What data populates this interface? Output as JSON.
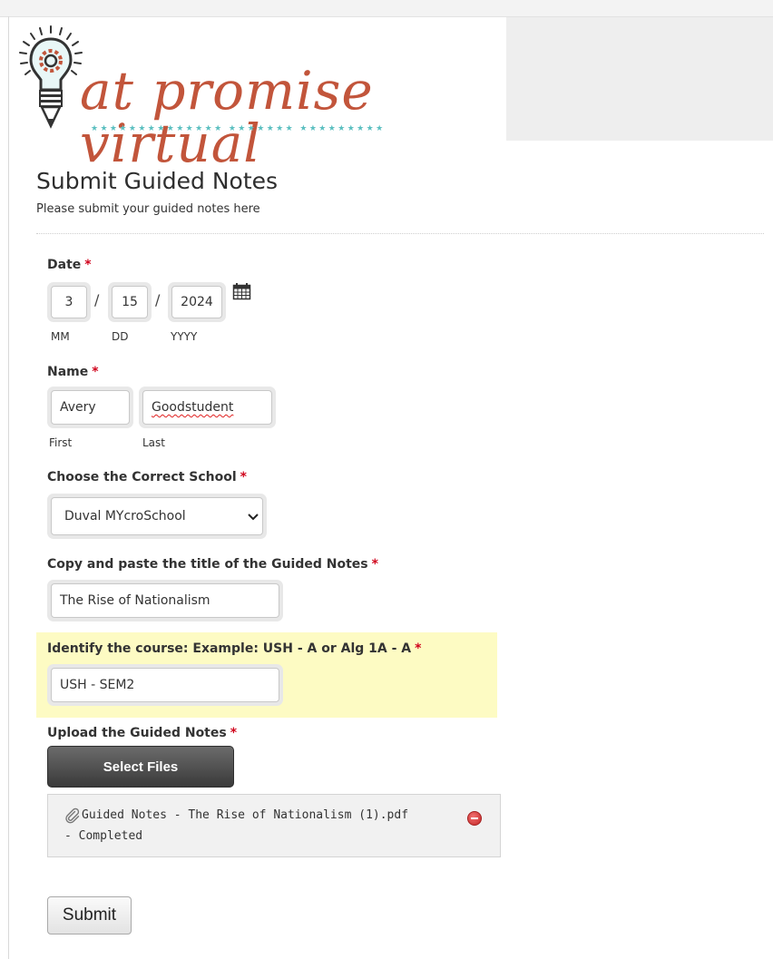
{
  "logo": {
    "text": "at promise virtual",
    "stars": "★★★★★★★★★★★★★★ ★★★★★★★ ★★★★★★★★★"
  },
  "form": {
    "title": "Submit Guided Notes",
    "description": "Please submit your guided notes here"
  },
  "date": {
    "label": "Date",
    "required": "*",
    "month": "3",
    "day": "15",
    "year": "2024",
    "separator": "/",
    "month_label": "MM",
    "day_label": "DD",
    "year_label": "YYYY"
  },
  "name": {
    "label": "Name",
    "required": "*",
    "first": "Avery",
    "last": "Goodstudent",
    "first_label": "First",
    "last_label": "Last"
  },
  "school": {
    "label": "Choose the Correct School",
    "required": "*",
    "selected": "Duval MYcroSchool"
  },
  "notes_title": {
    "label": "Copy and paste the title of the Guided Notes",
    "required": "*",
    "value": "The Rise of Nationalism"
  },
  "course": {
    "label": "Identify the course: Example: USH - A or Alg 1A - A",
    "required": "*",
    "value": "USH - SEM2"
  },
  "upload": {
    "label": "Upload the Guided Notes",
    "required": "*",
    "button": "Select Files",
    "file_name": "Guided Notes - The Rise of Nationalism (1).pdf",
    "file_status": "- Completed"
  },
  "submit": {
    "label": "Submit"
  },
  "colors": {
    "required": "#d0021b",
    "highlight": "#fdfbc3",
    "logo_text": "#c2553b",
    "logo_stars": "#5bbfc0"
  },
  "icons": {
    "logo": "lightbulb-gear-pencil-icon",
    "calendar": "calendar-icon",
    "dropdown": "chevron-down-icon",
    "attachment": "paperclip-icon",
    "remove": "remove-circle-icon"
  }
}
